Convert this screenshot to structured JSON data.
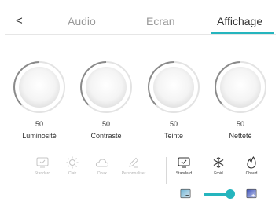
{
  "header": {
    "back_label": "<",
    "tabs": [
      {
        "label": "Audio",
        "active": false
      },
      {
        "label": "Ecran",
        "active": false
      },
      {
        "label": "Affichage",
        "active": true
      }
    ]
  },
  "dials": [
    {
      "label": "Luminosité",
      "value": "50",
      "level": 0.5
    },
    {
      "label": "Contraste",
      "value": "50",
      "level": 0.5
    },
    {
      "label": "Teinte",
      "value": "50",
      "level": 0.5
    },
    {
      "label": "Netteté",
      "value": "50",
      "level": 0.5
    }
  ],
  "color_modes_disabled": [
    {
      "label": "Standard",
      "icon": "monitor-check-icon"
    },
    {
      "label": "Clair",
      "icon": "sun-icon"
    },
    {
      "label": "Doux",
      "icon": "cloud-icon"
    },
    {
      "label": "Personnaliser",
      "icon": "pen-icon"
    }
  ],
  "color_temp_modes": [
    {
      "label": "Standard",
      "icon": "monitor-check-icon"
    },
    {
      "label": "Froid",
      "icon": "snowflake-icon"
    },
    {
      "label": "Chaud",
      "icon": "flame-icon"
    }
  ],
  "blue_light_slider": {
    "level": 0.7
  },
  "colors": {
    "accent": "#25b5be",
    "muted": "#b3b3b3",
    "text": "#333333"
  }
}
